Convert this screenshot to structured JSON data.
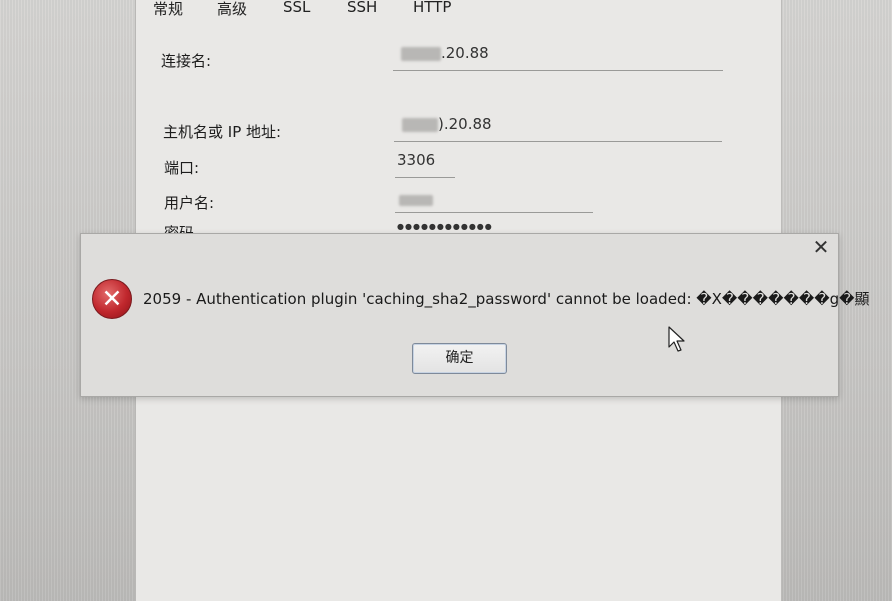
{
  "tabs": [
    "常规",
    "高级",
    "SSL",
    "SSH",
    "HTTP"
  ],
  "form": {
    "connection_name_label": "连接名:",
    "connection_name_value": ".20.88",
    "host_label": "主机名或 IP 地址:",
    "host_value": ").20.88",
    "port_label": "端口:",
    "port_value": "3306",
    "username_label": "用户名:",
    "password_label": "密码",
    "password_value": "●●●●●●●●●●●●"
  },
  "dialog": {
    "message": "2059 - Authentication plugin 'caching_sha2_password' cannot be loaded: �X�������g�顯",
    "ok_label": "确定",
    "close_glyph": "✕",
    "icon": "error-icon"
  }
}
